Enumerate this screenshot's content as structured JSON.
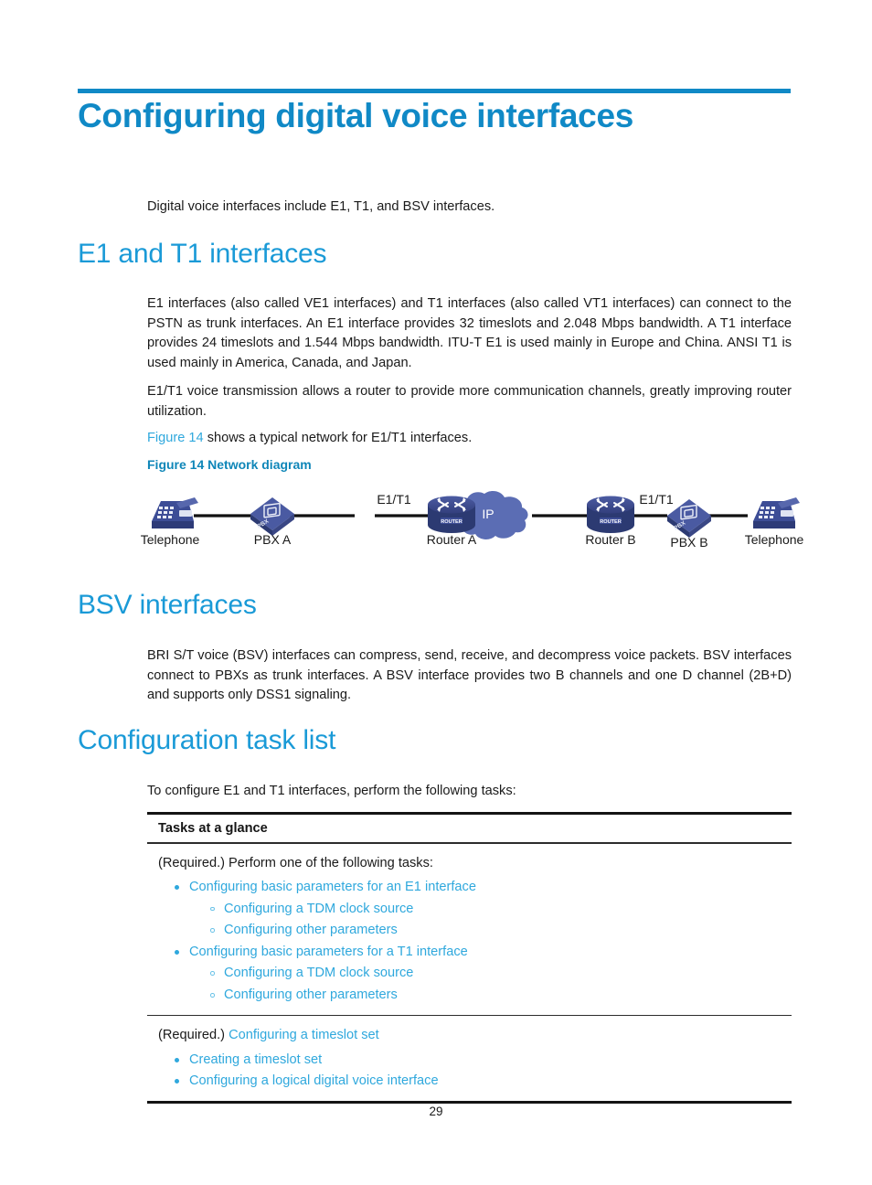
{
  "chapter": {
    "title": "Configuring digital voice interfaces",
    "intro": "Digital voice interfaces include E1, T1, and BSV interfaces."
  },
  "sections": {
    "e1t1": {
      "heading": "E1 and T1 interfaces",
      "para1": "E1 interfaces (also called VE1 interfaces) and T1 interfaces (also called VT1 interfaces) can connect to the PSTN as trunk interfaces. An E1 interface provides 32 timeslots and 2.048 Mbps bandwidth. A T1 interface provides 24 timeslots and 1.544 Mbps bandwidth. ITU-T E1 is used mainly in Europe and China. ANSI T1 is used mainly in America, Canada, and Japan.",
      "para2": "E1/T1 voice transmission allows a router to provide more communication channels, greatly improving router utilization.",
      "xref_link": "Figure 14",
      "xref_rest": " shows a typical network for E1/T1 interfaces."
    },
    "bsv": {
      "heading": "BSV interfaces",
      "para1": "BRI S/T voice (BSV) interfaces can compress, send, receive, and decompress voice packets. BSV interfaces connect to PBXs as trunk interfaces. A BSV interface provides two B channels and one D channel (2B+D) and supports only DSS1 signaling."
    },
    "tasklist": {
      "heading": "Configuration task list",
      "para1": "To configure E1 and T1 interfaces, perform the following tasks:"
    }
  },
  "figure": {
    "caption": "Figure 14 Network diagram",
    "nodes": [
      {
        "id": "telephone-left",
        "label": "Telephone",
        "icon": "telephone-icon"
      },
      {
        "id": "pbx-a",
        "label": "PBX A",
        "icon": "pbx-icon",
        "badge": "PBX"
      },
      {
        "id": "router-a",
        "label": "Router A",
        "icon": "router-icon",
        "badge": "ROUTER"
      },
      {
        "id": "ip-cloud",
        "label": "IP",
        "icon": "cloud-icon"
      },
      {
        "id": "router-b",
        "label": "Router B",
        "icon": "router-icon",
        "badge": "ROUTER"
      },
      {
        "id": "pbx-b",
        "label": "PBX B",
        "icon": "pbx-icon",
        "badge": "PBX"
      },
      {
        "id": "telephone-right",
        "label": "Telephone",
        "icon": "telephone-icon"
      }
    ],
    "link_label_left": "E1/T1",
    "link_label_right": "E1/T1"
  },
  "task_table": {
    "header": "Tasks at a glance",
    "group1": {
      "lead": "(Required.) Perform one of the following tasks:",
      "items": [
        {
          "label": "Configuring basic parameters for an E1 interface",
          "children": [
            "Configuring a TDM clock source",
            "Configuring other parameters"
          ]
        },
        {
          "label": "Configuring basic parameters for a T1 interface",
          "children": [
            "Configuring a TDM clock source",
            "Configuring other parameters"
          ]
        }
      ]
    },
    "group2": {
      "lead_plain": "(Required.) ",
      "lead_link": "Configuring a timeslot set",
      "items": [
        "Creating a timeslot set",
        "Configuring a logical digital voice interface"
      ]
    }
  },
  "footer": {
    "page_number": "29"
  },
  "colors": {
    "accent_blue": "#1089c6",
    "heading_blue": "#1a9ad7",
    "link_blue": "#2fa8dd",
    "caption_blue": "#0f86b8",
    "node_navy": "#3a4a8f",
    "node_dark": "#2c3a72",
    "cloud_blue": "#5b6db4",
    "line_black": "#111111"
  }
}
